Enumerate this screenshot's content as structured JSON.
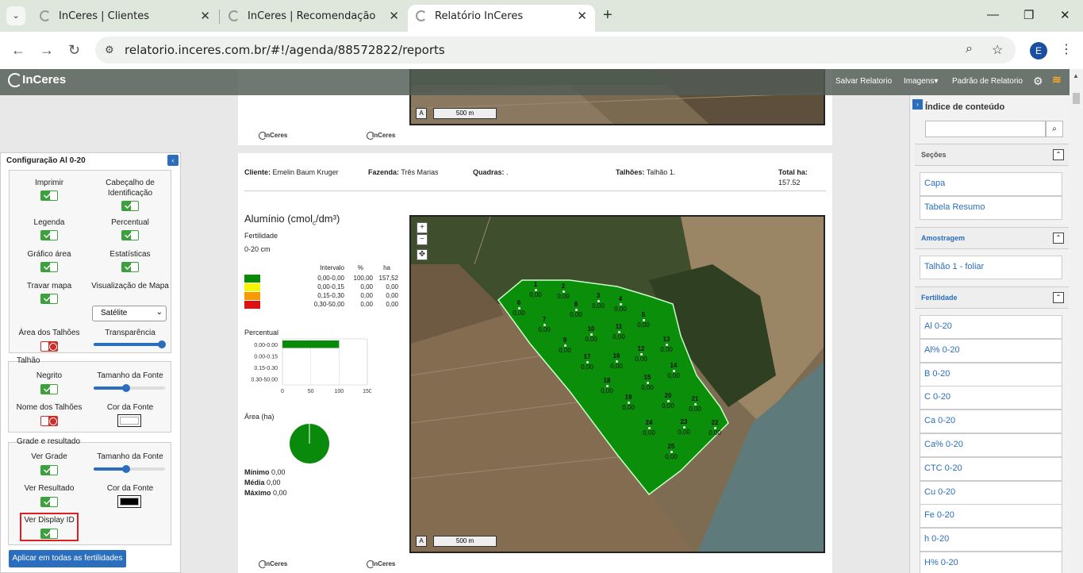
{
  "browser": {
    "tabs": [
      {
        "title": "InCeres | Clientes"
      },
      {
        "title": "InCeres | Recomendação"
      },
      {
        "title": "Relatório InCeres"
      }
    ],
    "url": "relatorio.inceres.com.br/#!/agenda/88572822/reports",
    "profile_initial": "E"
  },
  "appbar": {
    "logo": "InCeres",
    "menu": [
      "Salvar Relatorio",
      "Imagens",
      "Padrão de Relatorio"
    ]
  },
  "config": {
    "title": "Configuração Al 0-20",
    "imprimir": "Imprimir",
    "cabecalho": "Cabeçalho de Identificação",
    "legenda": "Legenda",
    "percentual": "Percentual",
    "grafico_area": "Gráfico área",
    "estatisticas": "Estatísticas",
    "travar_mapa": "Travar mapa",
    "visualizacao_mapa": "Visualização de Mapa",
    "visualizacao_value": "Satélite",
    "area_talhoes": "Área dos Talhões",
    "transparencia": "Transparência",
    "transparencia_level": 0.95,
    "talhao_group": "Talhão",
    "negrito": "Negrito",
    "tamanho_fonte": "Tamanho da Fonte",
    "talhao_fonte_level": 0.45,
    "nome_talhoes": "Nome dos Talhões",
    "cor_fonte": "Cor da Fonte",
    "grade_group": "Grade e resultado",
    "ver_grade": "Ver Grade",
    "grade_fonte_level": 0.45,
    "ver_resultado": "Ver Resultado",
    "ver_display_id": "Ver Display ID",
    "apply_all": "Aplicar em todas as fertilidades",
    "colors": {
      "talhao_font": "#ffffff",
      "grade_font": "#000000"
    }
  },
  "report": {
    "logo": "InCeres",
    "scale_label": "500 m",
    "north": "A",
    "cliente_label": "Cliente:",
    "cliente": "Emelin Baum Kruger",
    "fazenda_label": "Fazenda:",
    "fazenda": "Três Marias",
    "quadras_label": "Quadras:",
    "quadras": ".",
    "talhoes_label": "Talhões:",
    "talhoes": "Talhão 1.",
    "total_label": "Total ha:",
    "total": "157.52",
    "title_main": "Alumínio (cmol",
    "title_sub": "c",
    "title_end": "/dm³)",
    "fertilidade": "Fertilidade",
    "depth": "0-20 cm",
    "legend_headers": [
      "Intervalo",
      "%",
      "ha"
    ],
    "legend": [
      {
        "color": "#0a8a0a",
        "intervalo": "0,00-0,00",
        "pct": "100,00",
        "ha": "157,52"
      },
      {
        "color": "#f5f500",
        "intervalo": "0,00-0,15",
        "pct": "0,00",
        "ha": "0,00"
      },
      {
        "color": "#f59a00",
        "intervalo": "0,15-0,30",
        "pct": "0,00",
        "ha": "0,00"
      },
      {
        "color": "#e01010",
        "intervalo": "0,30-50,00",
        "pct": "0,00",
        "ha": "0,00"
      }
    ],
    "percentual_title": "Percentual",
    "area_title": "Área (ha)",
    "minimo_label": "Mínimo",
    "minimo": "0,00",
    "media_label": "Média",
    "media": "0,00",
    "maximo_label": "Máximo",
    "maximo": "0,00",
    "map_points": [
      {
        "id": "1",
        "v": "0,00"
      },
      {
        "id": "2",
        "v": "0,00"
      },
      {
        "id": "3",
        "v": "0,00"
      },
      {
        "id": "4",
        "v": "0,00"
      },
      {
        "id": "5",
        "v": "0,00"
      },
      {
        "id": "6",
        "v": "0,00"
      },
      {
        "id": "7",
        "v": "0,00"
      },
      {
        "id": "8",
        "v": "0,00"
      },
      {
        "id": "9",
        "v": "0,00"
      },
      {
        "id": "10",
        "v": "0,00"
      },
      {
        "id": "11",
        "v": "0,00"
      },
      {
        "id": "12",
        "v": "0,00"
      },
      {
        "id": "13",
        "v": "0,00"
      },
      {
        "id": "14",
        "v": "0,00"
      },
      {
        "id": "15",
        "v": "0,00"
      },
      {
        "id": "16",
        "v": "0,00"
      },
      {
        "id": "17",
        "v": "0,00"
      },
      {
        "id": "18",
        "v": "0,00"
      },
      {
        "id": "19",
        "v": "0,00"
      },
      {
        "id": "20",
        "v": "0,00"
      },
      {
        "id": "21",
        "v": "0,00"
      },
      {
        "id": "22",
        "v": "0,00"
      },
      {
        "id": "23",
        "v": "0,00"
      },
      {
        "id": "24",
        "v": "0,00"
      },
      {
        "id": "25",
        "v": "0,00"
      }
    ]
  },
  "chart_data": [
    {
      "type": "bar",
      "title": "Percentual",
      "categories": [
        "0.00-0.00",
        "0.00-0.15",
        "0.15-0.30",
        "0.30-50.00"
      ],
      "values": [
        100,
        0,
        0,
        0
      ],
      "xlim": [
        0,
        150
      ],
      "xticks": [
        0,
        50,
        100,
        150
      ],
      "color": "#0a8a0a",
      "orientation": "horizontal"
    },
    {
      "type": "pie",
      "title": "Área (ha)",
      "categories": [
        "0,00-0,00"
      ],
      "values": [
        157.52
      ],
      "color": "#0a8a0a"
    }
  ],
  "toc": {
    "title": "Índice de conteúdo",
    "secoes": "Seções",
    "secoes_items": [
      "Capa",
      "Tabela Resumo"
    ],
    "amostragem": "Amostragem",
    "amostragem_items": [
      "Talhão 1 - foliar"
    ],
    "fertilidade": "Fertilidade",
    "fertilidade_items": [
      "Al 0-20",
      "Al% 0-20",
      "B 0-20",
      "C 0-20",
      "Ca 0-20",
      "Ca% 0-20",
      "CTC 0-20",
      "Cu 0-20",
      "Fe 0-20",
      "h 0-20",
      "H% 0-20"
    ]
  }
}
